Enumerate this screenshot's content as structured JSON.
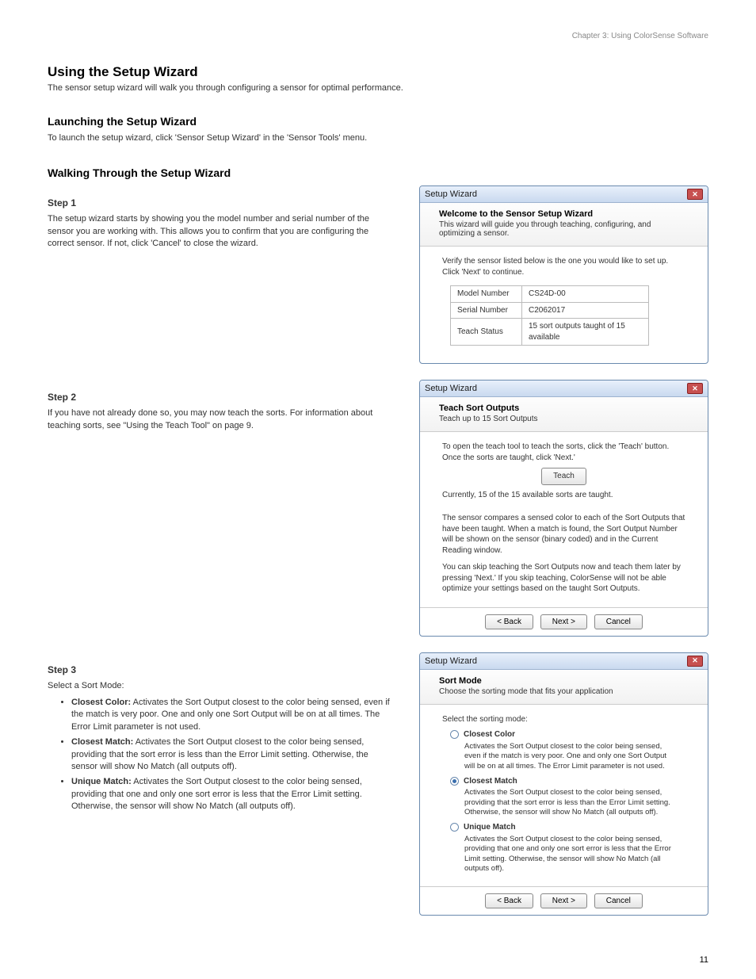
{
  "header_meta": "Chapter 3: Using ColorSense Software",
  "doc_title": "Using the Setup Wizard",
  "doc_subtitle": "The sensor setup wizard will walk you through configuring a sensor for optimal performance.",
  "section_launch_title": "Launching the Setup Wizard",
  "section_launch_body": "To launch the setup wizard, click 'Sensor Setup Wizard' in the 'Sensor Tools' menu.",
  "section_steps_title": "Walking Through the Setup Wizard",
  "step1_title": "Step 1",
  "step1_body": "The setup wizard starts by showing you the model number and serial number of the sensor you are working with. This allows you to confirm that you are configuring the correct sensor. If not, click 'Cancel' to close the wizard.",
  "step2_title": "Step 2",
  "step2_body": "If you have not already done so, you may now teach the sorts. For information about teaching sorts, see \"Using the Teach Tool\" on page 9.",
  "step3_title": "Step 3",
  "step3_body": "Select a Sort Mode:",
  "bullets": [
    {
      "bold": "Closest Color:",
      "text": " Activates the Sort Output closest to the color being sensed, even if the match is very poor. One and only one Sort Output will be on at all times. The Error Limit parameter is not used."
    },
    {
      "bold": "Closest Match:",
      "text": " Activates the Sort Output closest to the color being sensed, providing that the sort error is less than the Error Limit setting. Otherwise, the sensor will show No Match (all outputs off)."
    },
    {
      "bold": "Unique Match:",
      "text": " Activates the Sort Output closest to the color being sensed, providing that one and only one sort error is less that the Error Limit setting. Otherwise, the sensor will show No Match (all outputs off)."
    }
  ],
  "wiz_title": "Setup Wizard",
  "wiz1": {
    "h1": "Welcome to the Sensor Setup Wizard",
    "h2": "This wizard will guide you through teaching, configuring, and optimizing a sensor.",
    "verify": "Verify the sensor listed below is the one you would like to set up. Click 'Next' to continue.",
    "rows": [
      {
        "label": "Model Number",
        "val": "CS24D-00"
      },
      {
        "label": "Serial Number",
        "val": "C2062017"
      },
      {
        "label": "Teach Status",
        "val": "15 sort outputs taught of 15 available"
      }
    ]
  },
  "wiz2": {
    "h1": "Teach Sort Outputs",
    "h2": "Teach up to 15 Sort Outputs",
    "instr": "To open the teach tool to teach the sorts, click the 'Teach' button. Once the sorts are taught, click 'Next.'",
    "teach_btn": "Teach",
    "status": "Currently, 15 of the 15 available sorts are taught.",
    "p1": "The sensor compares a sensed color to each of the Sort Outputs that have been taught. When a match is found, the Sort Output Number will be shown on the sensor (binary coded) and in the Current Reading window.",
    "p2": "You can skip teaching the Sort Outputs now and teach them later by pressing 'Next.' If you skip teaching, ColorSense will not be able optimize your settings based on the taught Sort Outputs.",
    "back": "< Back",
    "next": "Next >",
    "cancel": "Cancel"
  },
  "wiz3": {
    "h1": "Sort Mode",
    "h2": "Choose the sorting mode that fits your application",
    "select_label": "Select the sorting mode:",
    "opts": [
      {
        "label": "Closest Color",
        "selected": false,
        "desc": "Activates the Sort Output closest to the color being sensed, even if the match is very poor. One and only one Sort Output will be on at all times. The Error Limit parameter is not used."
      },
      {
        "label": "Closest Match",
        "selected": true,
        "desc": "Activates the Sort Output closest to the color being sensed, providing that the sort error is less than the Error Limit setting. Otherwise, the sensor will show No Match (all outputs off)."
      },
      {
        "label": "Unique Match",
        "selected": false,
        "desc": "Activates the Sort Output closest to the color being sensed, providing that one and only one sort error is less that the Error Limit setting. Otherwise, the sensor will show No Match (all outputs off)."
      }
    ],
    "back": "< Back",
    "next": "Next >",
    "cancel": "Cancel"
  },
  "page_num": "11"
}
